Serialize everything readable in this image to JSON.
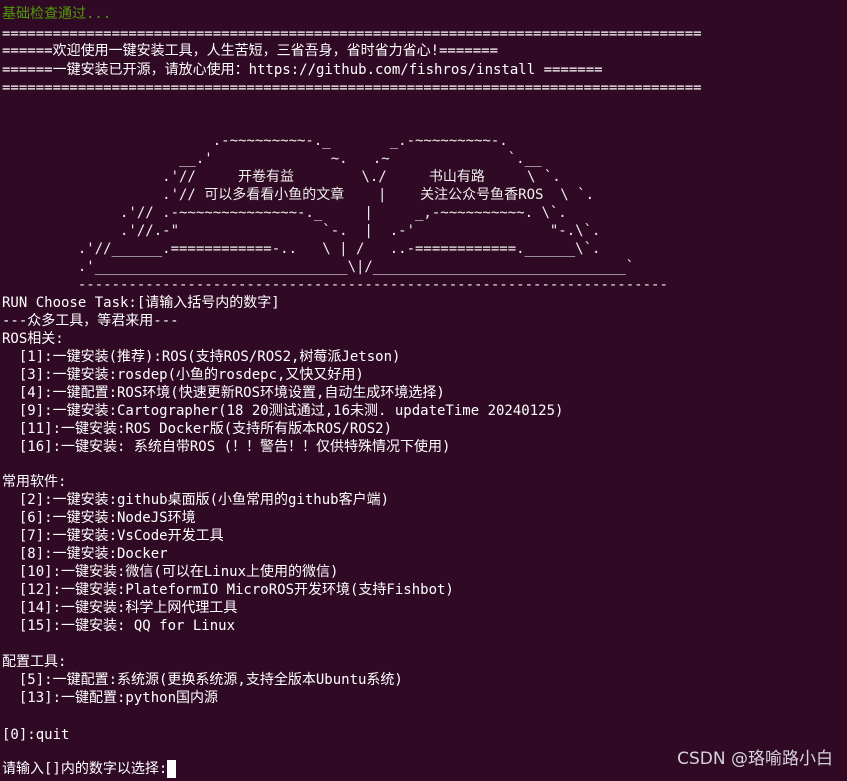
{
  "terminal": {
    "background": "#300a24",
    "text_color": "#ffffff",
    "accent_green": "#4e9a06",
    "check_status": "基础检查通过...",
    "banner": {
      "rule": "===================================================================================",
      "welcome": "======欢迎使用一键安装工具，人生苦短，三省吾身，省时省力省心!=======",
      "open_source": "======一键安装已开源，请放心使用：https://github.com/fishros/install ======="
    },
    "ascii_art": [
      "                         .-~~~~~~~~~-._       _.-~~~~~~~~~-.",
      "                     __.'              ~.   .~              `.__",
      "                   .'//     开卷有益        \\./     书山有路     \\ `.",
      "                   .'// 可以多看看小鱼的文章    |    关注公众号鱼香ROS  \\ `.",
      "              .'// .-~~~~~~~~~~~~~~-._     |     _,-~~~~~~~~~~. \\`.",
      "              .'//.-\"                 `-.  |  .-'                \"-.\\`.",
      "         .'//______.============-..   \\ | /   ..-============.______\\`.",
      "         .'______________________________\\|/______________________________`",
      "         ----------------------------------------------------------------------"
    ],
    "menu": {
      "header": "RUN Choose Task:[请输入括号内的数字]",
      "tagline": "---众多工具，等君来用---",
      "sections": [
        {
          "title": "ROS相关:",
          "items": [
            "  [1]:一键安装(推荐):ROS(支持ROS/ROS2,树莓派Jetson)",
            "  [3]:一键安装:rosdep(小鱼的rosdepc,又快又好用)",
            "  [4]:一键配置:ROS环境(快速更新ROS环境设置,自动生成环境选择)",
            "  [9]:一键安装:Cartographer(18 20测试通过,16未测. updateTime 20240125)",
            "  [11]:一键安装:ROS Docker版(支持所有版本ROS/ROS2)",
            "  [16]:一键安装: 系统自带ROS (！！警告！！仅供特殊情况下使用)"
          ]
        },
        {
          "title": "常用软件:",
          "items": [
            "  [2]:一键安装:github桌面版(小鱼常用的github客户端)",
            "  [6]:一键安装:NodeJS环境",
            "  [7]:一键安装:VsCode开发工具",
            "  [8]:一键安装:Docker",
            "  [10]:一键安装:微信(可以在Linux上使用的微信)",
            "  [12]:一键安装:PlateformIO MicroROS开发环境(支持Fishbot)",
            "  [14]:一键安装:科学上网代理工具",
            "  [15]:一键安装: QQ for Linux"
          ]
        },
        {
          "title": "配置工具:",
          "items": [
            "  [5]:一键配置:系统源(更换系统源,支持全版本Ubuntu系统)",
            "  [13]:一键配置:python国内源"
          ]
        }
      ],
      "quit": "[0]:quit"
    },
    "input_prompt": "请输入[]内的数字以选择:",
    "watermark": "CSDN @珞喻路小白"
  }
}
